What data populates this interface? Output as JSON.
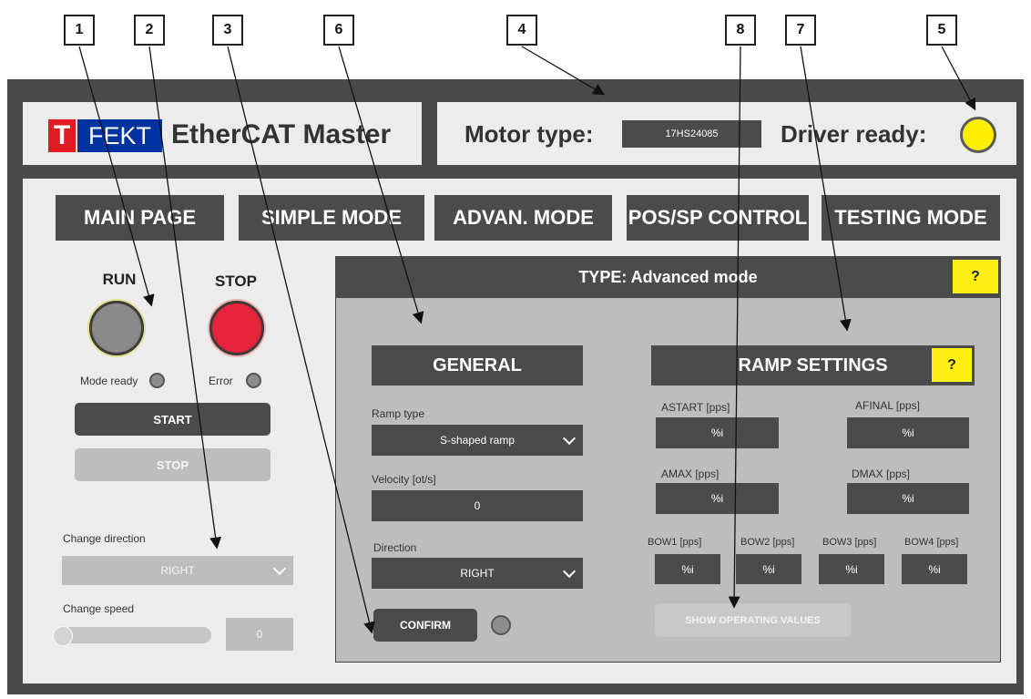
{
  "callouts": [
    "1",
    "2",
    "3",
    "6",
    "4",
    "8",
    "7",
    "5"
  ],
  "header": {
    "logo_t": "T",
    "logo_fekt": "FEKT",
    "title": "EtherCAT Master",
    "motor_type_label": "Motor type:",
    "motor_type_value": "17HS24085",
    "driver_ready_label": "Driver ready:"
  },
  "nav": [
    "MAIN PAGE",
    "SIMPLE MODE",
    "ADVAN. MODE",
    "POS/SP CONTROL",
    "TESTING MODE"
  ],
  "left": {
    "run_label": "RUN",
    "stop_label": "STOP",
    "mode_ready": "Mode ready",
    "error": "Error",
    "start_btn": "START",
    "stop_btn": "STOP",
    "change_direction": "Change direction",
    "direction_value": "RIGHT",
    "change_speed": "Change speed",
    "speed_value": "0"
  },
  "panel": {
    "title": "TYPE: Advanced mode",
    "help": "?",
    "general": {
      "header": "GENERAL",
      "ramp_type_label": "Ramp type",
      "ramp_type_value": "S-shaped ramp",
      "velocity_label": "Velocity [ot/s]",
      "velocity_value": "0",
      "direction_label": "Direction",
      "direction_value": "RIGHT",
      "confirm": "CONFIRM"
    },
    "ramp": {
      "header": "RAMP SETTINGS",
      "help": "?",
      "astart": "ASTART [pps]",
      "afinal": "AFINAL [pps]",
      "amax": "AMAX [pps]",
      "dmax": "DMAX [pps]",
      "bow1": "BOW1 [pps]",
      "bow2": "BOW2 [pps]",
      "bow3": "BOW3 [pps]",
      "bow4": "BOW4 [pps]",
      "placeholder": "%i",
      "show_values": "SHOW OPERATING VALUES"
    }
  },
  "colors": {
    "accent_red": "#e01b22",
    "logo_blue": "#0033a0",
    "lamp_yellow": "#ffee00",
    "stop_red": "#e8243c"
  }
}
